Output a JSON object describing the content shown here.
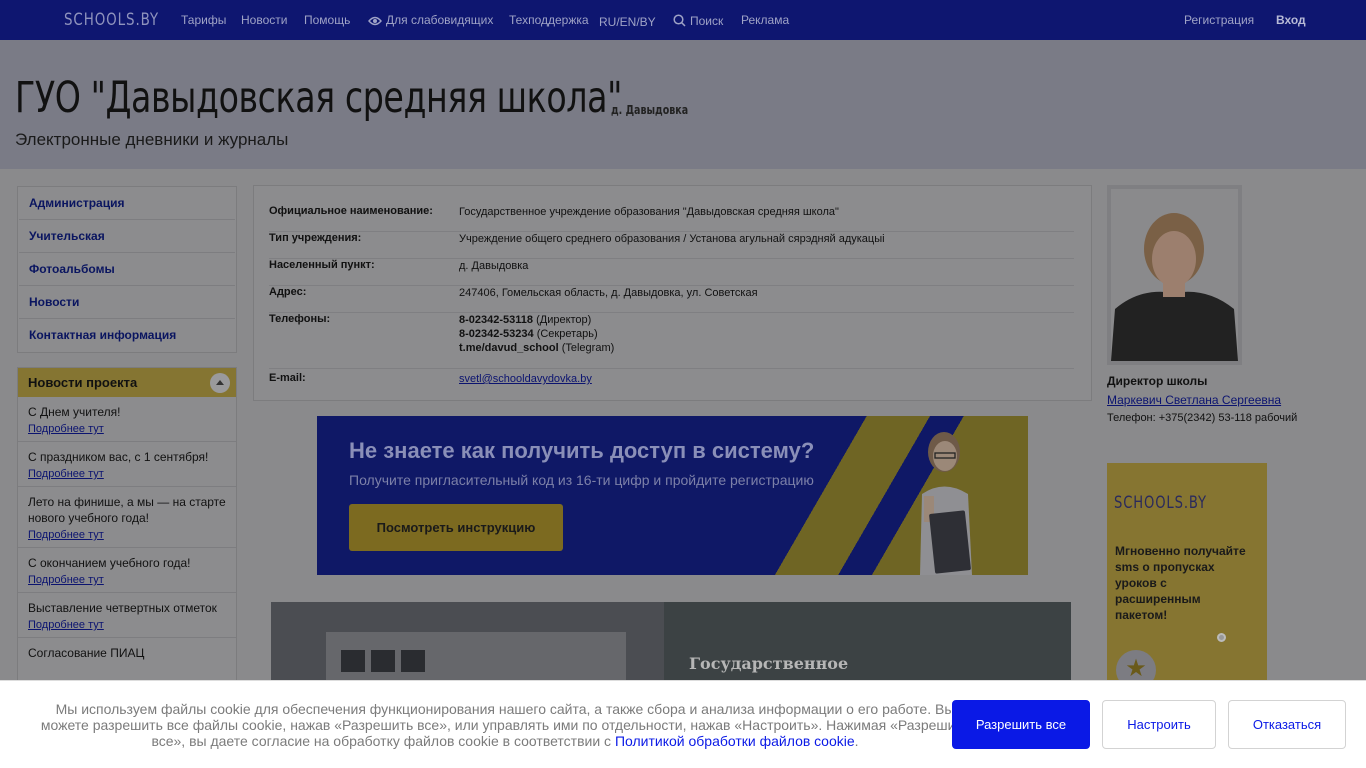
{
  "topbar": {
    "logo": "SCHOOLS.BY",
    "nav": [
      "Тарифы",
      "Новости",
      "Помощь",
      "Для слабовидящих",
      "Техподдержка",
      "RU/EN/BY",
      "Поиск",
      "Реклама"
    ],
    "register": "Регистрация",
    "login": "Вход"
  },
  "header": {
    "title": "ГУО \"Давыдовская средняя школа\"",
    "town": "д. Давыдовка",
    "subtitle": "Электронные дневники и журналы"
  },
  "sidemenu": [
    "Администрация",
    "Учительская",
    "Фотоальбомы",
    "Новости",
    "Контактная информация"
  ],
  "project_news": {
    "title": "Новости проекта",
    "more_label": "Подробнее тут",
    "items": [
      "С Днем учителя!",
      "С праздником вас, с 1 сентября!",
      "Лето на финише, а мы — на старте нового учебного года!",
      "С окончанием учебного года!",
      "Выставление четвертных отметок",
      "Согласование ПИАЦ"
    ]
  },
  "info": {
    "official_name": {
      "label": "Официальное наименование:",
      "value": "Государственное учреждение образования \"Давыдовская средняя школа\""
    },
    "type": {
      "label": "Тип учреждения:",
      "value": "Учреждение общего среднего образования / Установа агульнай сярэдняй адукацыі"
    },
    "locality": {
      "label": "Населенный пункт:",
      "value": "д. Давыдовка"
    },
    "address": {
      "label": "Адрес:",
      "value": "247406, Гомельская область, д. Давыдовка, ул. Советская"
    },
    "phones": {
      "label": "Телефоны:",
      "list": [
        {
          "number": "8-02342-53118",
          "note": "(Директор)"
        },
        {
          "number": "8-02342-53234",
          "note": "(Секретарь)"
        },
        {
          "number": "t.me/davud_school",
          "note": "(Telegram)"
        }
      ]
    },
    "email": {
      "label": "E-mail:",
      "value": "svetl@schooldavydovka.by"
    }
  },
  "banner": {
    "heading": "Не знаете как получить доступ в систему?",
    "sub": "Получите пригласительный код из 16-ти цифр и пройдите регистрацию",
    "button": "Посмотреть инструкцию"
  },
  "photo_caption": "Государственное",
  "director": {
    "caption": "Директор школы",
    "name": "Маркевич Светлана Сергеевна",
    "phone": "Телефон: +375(2342) 53-118 рабочий"
  },
  "ad": {
    "logo": "SCHOOLS.BY",
    "text": "Мгновенно получайте sms о пропусках уроков с расширенным пакетом!"
  },
  "cookie": {
    "message": "Мы используем файлы cookie для обеспечения функционирования нашего сайта, а также сбора и анализа информации о его работе. Вы можете разрешить все файлы cookie, нажав «Разрешить все», или управлять ими по отдельности, нажав «Настроить». Нажимая «Разрешить все», вы даете согласие на обработку файлов cookie в соответствии с",
    "link": "Политикой обработки файлов cookie",
    "allow_all": "Разрешить все",
    "configure": "Настроить",
    "decline": "Отказаться",
    "accent": "#0a19e6"
  }
}
